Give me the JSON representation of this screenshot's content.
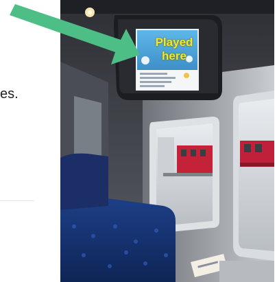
{
  "left_text": {
    "fragment": "es."
  },
  "photo": {
    "annotation": "Played\nhere",
    "annotation_color": "#f4e62a",
    "arrow_color": "#4dbf86"
  }
}
